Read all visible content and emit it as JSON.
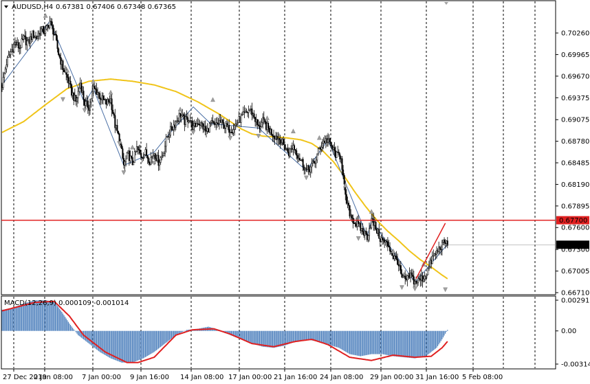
{
  "header": {
    "symbol_label": "AUDUSD,H4",
    "ohlc_label": "0.67381 0.67406 0.67348 0.67365"
  },
  "indicator": {
    "label": "MACD(12,26,9) 0.000109 -0.001014"
  },
  "colors": {
    "background": "#ffffff",
    "grid": "#000000",
    "candle_up": "#ffffff",
    "candle_down": "#000000",
    "wick": "#000000",
    "ma_line": "#f0c419",
    "zigzag": "#4a6fa5",
    "level_line": "#e02020",
    "trend_line": "#e02020",
    "macd_hist": "#4f81bd",
    "macd_signal": "#e02020",
    "fractal": "#a0a0a0",
    "price_tag_bg": "#000000"
  },
  "chart_data": [
    {
      "type": "candlestick",
      "title": "AUDUSD,H4",
      "ylim": [
        0.6671,
        0.7042
      ],
      "y_ticks": [
        0.7026,
        0.69965,
        0.6967,
        0.69375,
        0.69075,
        0.6878,
        0.68485,
        0.6819,
        0.67895,
        0.676,
        0.673,
        0.67005,
        0.6671
      ],
      "y_tick_labels": [
        "0.70260",
        "0.69965",
        "0.69670",
        "0.69375",
        "0.69075",
        "0.68780",
        "0.68485",
        "0.68190",
        "0.67895",
        "0.67600",
        "0.67300",
        "0.67005",
        "0.66710"
      ],
      "x_tick_labels": [
        "27 Dec 2019",
        "2 Jan 08:00",
        "7 Jan 00:00",
        "9 Jan 16:00",
        "14 Jan 08:00",
        "17 Jan 00:00",
        "21 Jan 16:00",
        "24 Jan 08:00",
        "29 Jan 00:00",
        "31 Jan 16:00",
        "5 Feb 08:00"
      ],
      "current_price": 0.67365,
      "current_price_label": "0.67365",
      "horizontal_level": 0.677,
      "horizontal_level_label": "0.67700",
      "close_path": [
        [
          0,
          0.6955
        ],
        [
          4,
          0.6985
        ],
        [
          8,
          0.7
        ],
        [
          12,
          0.7012
        ],
        [
          16,
          0.7006
        ],
        [
          20,
          0.7018
        ],
        [
          24,
          0.7012
        ],
        [
          28,
          0.7024
        ],
        [
          32,
          0.702
        ],
        [
          36,
          0.703
        ],
        [
          40,
          0.7028
        ],
        [
          44,
          0.7042
        ],
        [
          48,
          0.7025
        ],
        [
          52,
          0.6998
        ],
        [
          56,
          0.6978
        ],
        [
          60,
          0.6965
        ],
        [
          64,
          0.6945
        ],
        [
          68,
          0.6932
        ],
        [
          72,
          0.6958
        ],
        [
          76,
          0.693
        ],
        [
          80,
          0.6925
        ],
        [
          84,
          0.695
        ],
        [
          88,
          0.6945
        ],
        [
          92,
          0.6935
        ],
        [
          96,
          0.693
        ],
        [
          100,
          0.6935
        ],
        [
          104,
          0.69
        ],
        [
          108,
          0.688
        ],
        [
          112,
          0.6845
        ],
        [
          116,
          0.686
        ],
        [
          120,
          0.6848
        ],
        [
          124,
          0.6868
        ],
        [
          128,
          0.6858
        ],
        [
          132,
          0.6862
        ],
        [
          136,
          0.6852
        ],
        [
          140,
          0.6863
        ],
        [
          144,
          0.685
        ],
        [
          148,
          0.686
        ],
        [
          152,
          0.6885
        ],
        [
          156,
          0.6895
        ],
        [
          160,
          0.6905
        ],
        [
          164,
          0.6915
        ],
        [
          168,
          0.6905
        ],
        [
          172,
          0.691
        ],
        [
          176,
          0.6895
        ],
        [
          180,
          0.6905
        ],
        [
          184,
          0.69
        ],
        [
          188,
          0.689
        ],
        [
          192,
          0.6902
        ],
        [
          196,
          0.6898
        ],
        [
          200,
          0.6905
        ],
        [
          204,
          0.69
        ],
        [
          208,
          0.6895
        ],
        [
          212,
          0.6895
        ],
        [
          216,
          0.6903
        ],
        [
          220,
          0.691
        ],
        [
          224,
          0.6915
        ],
        [
          228,
          0.6922
        ],
        [
          232,
          0.6912
        ],
        [
          236,
          0.6896
        ],
        [
          240,
          0.6905
        ],
        [
          244,
          0.6897
        ],
        [
          248,
          0.689
        ],
        [
          252,
          0.6885
        ],
        [
          256,
          0.688
        ],
        [
          260,
          0.687
        ],
        [
          264,
          0.6862
        ],
        [
          268,
          0.6872
        ],
        [
          272,
          0.686
        ],
        [
          276,
          0.685
        ],
        [
          280,
          0.6838
        ],
        [
          284,
          0.6842
        ],
        [
          288,
          0.685
        ],
        [
          292,
          0.6868
        ],
        [
          296,
          0.6878
        ],
        [
          300,
          0.688
        ],
        [
          304,
          0.6868
        ],
        [
          308,
          0.6858
        ],
        [
          312,
          0.6858
        ],
        [
          316,
          0.68
        ],
        [
          320,
          0.678
        ],
        [
          324,
          0.6768
        ],
        [
          328,
          0.6762
        ],
        [
          332,
          0.6755
        ],
        [
          336,
          0.6748
        ],
        [
          340,
          0.677
        ],
        [
          344,
          0.676
        ],
        [
          348,
          0.6745
        ],
        [
          352,
          0.674
        ],
        [
          356,
          0.6735
        ],
        [
          360,
          0.672
        ],
        [
          364,
          0.6715
        ],
        [
          368,
          0.669
        ],
        [
          372,
          0.6688
        ],
        [
          376,
          0.6695
        ],
        [
          380,
          0.6685
        ],
        [
          384,
          0.6688
        ],
        [
          388,
          0.6692
        ],
        [
          392,
          0.6702
        ],
        [
          396,
          0.6718
        ],
        [
          400,
          0.6726
        ],
        [
          404,
          0.6735
        ],
        [
          408,
          0.674
        ],
        [
          410,
          0.6737
        ]
      ],
      "moving_average": [
        [
          0,
          0.689
        ],
        [
          20,
          0.6905
        ],
        [
          40,
          0.6928
        ],
        [
          60,
          0.695
        ],
        [
          80,
          0.696
        ],
        [
          100,
          0.6963
        ],
        [
          120,
          0.696
        ],
        [
          140,
          0.6955
        ],
        [
          160,
          0.6946
        ],
        [
          180,
          0.6932
        ],
        [
          200,
          0.6915
        ],
        [
          210,
          0.6905
        ],
        [
          220,
          0.6895
        ],
        [
          230,
          0.6888
        ],
        [
          240,
          0.6885
        ],
        [
          260,
          0.6883
        ],
        [
          275,
          0.688
        ],
        [
          285,
          0.6875
        ],
        [
          295,
          0.6865
        ],
        [
          305,
          0.685
        ],
        [
          315,
          0.683
        ],
        [
          325,
          0.6808
        ],
        [
          335,
          0.6788
        ],
        [
          345,
          0.677
        ],
        [
          355,
          0.6755
        ],
        [
          365,
          0.6742
        ],
        [
          375,
          0.6728
        ],
        [
          385,
          0.6716
        ],
        [
          395,
          0.6706
        ],
        [
          405,
          0.6695
        ],
        [
          410,
          0.669
        ]
      ]
    },
    {
      "type": "bar",
      "title": "MACD(12,26,9) 0.000109 -0.001014",
      "ylim": [
        -0.003144,
        0.002911
      ],
      "y_tick_labels": [
        "0.002911",
        "0.00",
        "-0.003144"
      ],
      "y_ticks": [
        0.002911,
        0.0,
        -0.003144
      ],
      "main_value": 0.000109,
      "signal_value": -0.001014,
      "histogram": [
        [
          0,
          0.002
        ],
        [
          10,
          0.0022
        ],
        [
          20,
          0.0026
        ],
        [
          30,
          0.0029
        ],
        [
          40,
          0.0029
        ],
        [
          48,
          0.0028
        ],
        [
          55,
          0.0018
        ],
        [
          62,
          0.0007
        ],
        [
          70,
          -0.0004
        ],
        [
          80,
          -0.0012
        ],
        [
          90,
          -0.002
        ],
        [
          100,
          -0.0026
        ],
        [
          110,
          -0.003
        ],
        [
          120,
          -0.003
        ],
        [
          130,
          -0.0026
        ],
        [
          140,
          -0.002
        ],
        [
          150,
          -0.0012
        ],
        [
          160,
          -0.0004
        ],
        [
          170,
          0.0001
        ],
        [
          180,
          0.0002
        ],
        [
          190,
          0.0004
        ],
        [
          200,
          0.0001
        ],
        [
          210,
          -0.0004
        ],
        [
          220,
          -0.0008
        ],
        [
          230,
          -0.0012
        ],
        [
          240,
          -0.0015
        ],
        [
          250,
          -0.0016
        ],
        [
          260,
          -0.0014
        ],
        [
          270,
          -0.001
        ],
        [
          280,
          -0.0008
        ],
        [
          290,
          -0.001
        ],
        [
          300,
          -0.0013
        ],
        [
          310,
          -0.0016
        ],
        [
          320,
          -0.0022
        ],
        [
          330,
          -0.0024
        ],
        [
          340,
          -0.0022
        ],
        [
          350,
          -0.0022
        ],
        [
          360,
          -0.0024
        ],
        [
          370,
          -0.0025
        ],
        [
          380,
          -0.0026
        ],
        [
          390,
          -0.0024
        ],
        [
          400,
          -0.0016
        ],
        [
          405,
          -0.0008
        ],
        [
          410,
          0.0001
        ]
      ],
      "signal": [
        [
          0,
          0.0019
        ],
        [
          15,
          0.0023
        ],
        [
          30,
          0.0027
        ],
        [
          48,
          0.0028
        ],
        [
          62,
          0.0014
        ],
        [
          75,
          -0.0004
        ],
        [
          95,
          -0.002
        ],
        [
          115,
          -0.003
        ],
        [
          125,
          -0.003
        ],
        [
          140,
          -0.0025
        ],
        [
          160,
          -0.0004
        ],
        [
          175,
          0.0001
        ],
        [
          195,
          0.0002
        ],
        [
          210,
          -0.0003
        ],
        [
          230,
          -0.0012
        ],
        [
          250,
          -0.0015
        ],
        [
          270,
          -0.001
        ],
        [
          285,
          -0.0008
        ],
        [
          300,
          -0.0013
        ],
        [
          320,
          -0.0025
        ],
        [
          340,
          -0.0028
        ],
        [
          360,
          -0.0023
        ],
        [
          380,
          -0.0025
        ],
        [
          395,
          -0.0024
        ],
        [
          405,
          -0.0016
        ],
        [
          410,
          -0.001
        ]
      ]
    }
  ]
}
